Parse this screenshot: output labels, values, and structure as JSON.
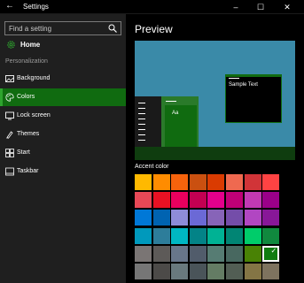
{
  "window": {
    "title": "Settings",
    "back_glyph": "←",
    "min_glyph": "–",
    "max_glyph": "☐",
    "close_glyph": "✕"
  },
  "sidebar": {
    "search_placeholder": "Find a setting",
    "home_label": "Home",
    "section_label": "Personalization",
    "items": [
      {
        "label": "Background",
        "icon": "background-icon"
      },
      {
        "label": "Colors",
        "icon": "palette-icon",
        "active": true
      },
      {
        "label": "Lock screen",
        "icon": "lock-screen-icon"
      },
      {
        "label": "Themes",
        "icon": "themes-icon"
      },
      {
        "label": "Start",
        "icon": "start-icon"
      },
      {
        "label": "Taskbar",
        "icon": "taskbar-icon"
      }
    ]
  },
  "main": {
    "heading": "Preview",
    "preview_sample_text": "Sample Text",
    "preview_tile_text": "Aa",
    "accent_heading": "Accent color"
  },
  "accent_colors": [
    [
      "#ffb900",
      "#ff8c00",
      "#f7630c",
      "#ca5010",
      "#da3b01",
      "#ef6950",
      "#d13438",
      "#ff4343"
    ],
    [
      "#e74856",
      "#e81123",
      "#ea005e",
      "#c30052",
      "#e3008c",
      "#bf0077",
      "#c239b3",
      "#9a0089"
    ],
    [
      "#0078d7",
      "#0063b1",
      "#8e8cd8",
      "#6b69d6",
      "#8764b8",
      "#744da9",
      "#b146c2",
      "#881798"
    ],
    [
      "#0099bc",
      "#2d7d9a",
      "#00b7c3",
      "#038387",
      "#00b294",
      "#018574",
      "#00cc6a",
      "#10893e"
    ],
    [
      "#7a7574",
      "#5d5a58",
      "#68768a",
      "#515c6b",
      "#567c73",
      "#486860",
      "#498205",
      "#107c10"
    ],
    [
      "#767676",
      "#4c4a48",
      "#69797e",
      "#4a5459",
      "#647c64",
      "#525e54",
      "#847545",
      "#7e735f"
    ]
  ],
  "selected_color": "#107c10",
  "selected_glyph": "✓"
}
